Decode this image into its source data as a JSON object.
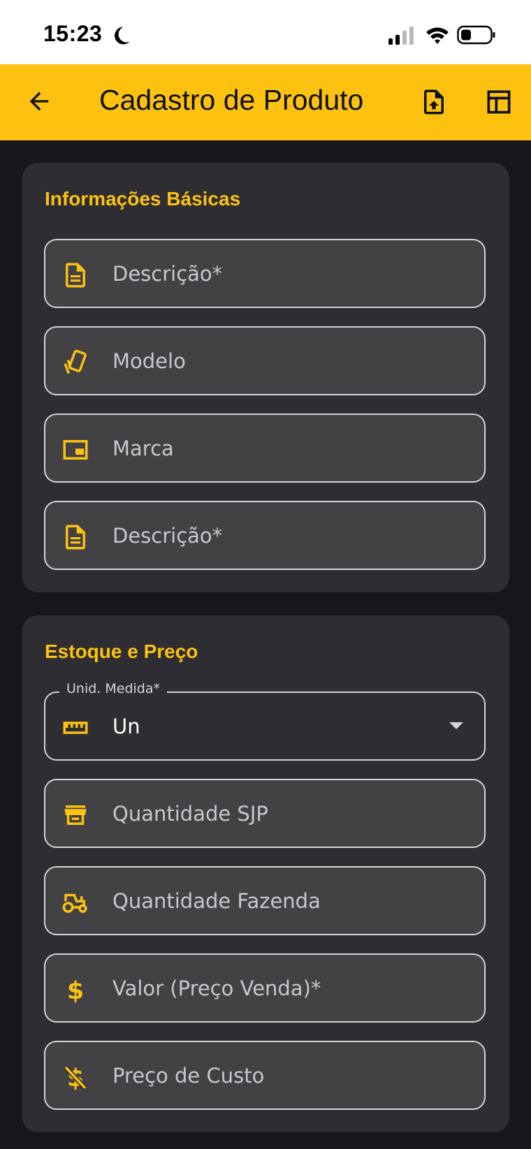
{
  "status_bar": {
    "time": "15:23",
    "icons": [
      "moon-icon",
      "signal-icon",
      "wifi-icon",
      "battery-icon"
    ]
  },
  "app_bar": {
    "title": "Cadastro de Produto",
    "background": "#fcc20f",
    "actions": [
      "back-arrow-icon",
      "file-upload-icon",
      "table-layout-icon"
    ]
  },
  "colors": {
    "accent": "#fcc20f",
    "background": "#17161b",
    "card": "#2e2d31",
    "field": "#424144"
  },
  "sections": {
    "basic": {
      "title": "Informações Básicas",
      "fields": [
        {
          "label": "Descrição*",
          "icon": "document-icon"
        },
        {
          "label": "Modelo",
          "icon": "style-cards-icon"
        },
        {
          "label": "Marca",
          "icon": "picture-in-picture-icon"
        },
        {
          "label": "Descrição*",
          "icon": "document-icon"
        }
      ]
    },
    "stock": {
      "title": "Estoque e Preço",
      "unit": {
        "label": "Unid. Medida*",
        "value": "Un",
        "icon": "ruler-icon"
      },
      "fields": [
        {
          "label": "Quantidade SJP",
          "icon": "storefront-icon"
        },
        {
          "label": "Quantidade Fazenda",
          "icon": "tractor-icon"
        },
        {
          "label": "Valor (Preço Venda)*",
          "icon": "dollar-icon"
        },
        {
          "label": "Preço de Custo",
          "icon": "money-off-icon"
        }
      ]
    }
  }
}
